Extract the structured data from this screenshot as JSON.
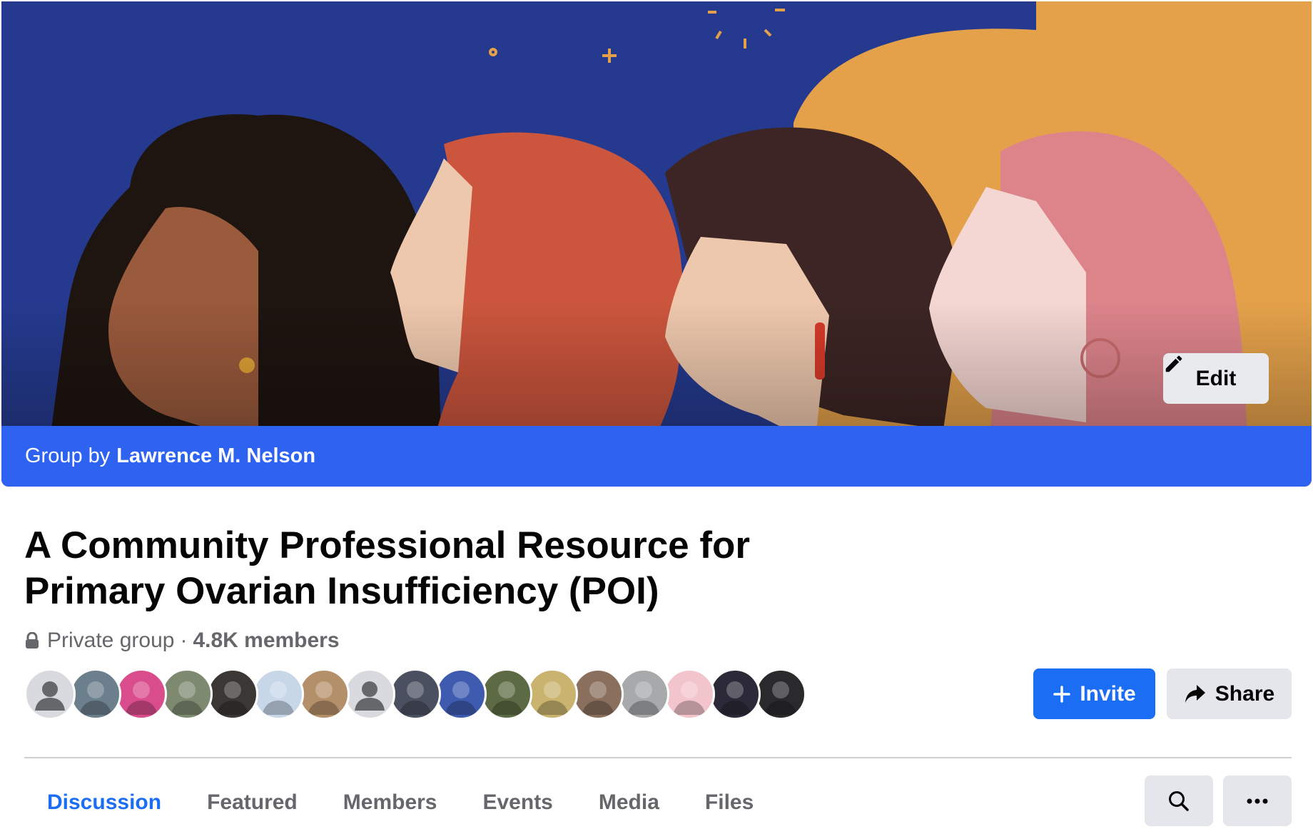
{
  "cover": {
    "edit_label": "Edit",
    "colors": {
      "sky": "#253a8f",
      "sun": "#e4a14a"
    }
  },
  "banner": {
    "prefix": "Group by",
    "owner": "Lawrence M. Nelson",
    "color": "#2d63f0"
  },
  "group": {
    "title": "A Community Professional Resource for Primary Ovarian Insufficiency (POI)",
    "privacy": "Private group",
    "separator": "·",
    "members": "4.8K members"
  },
  "actions": {
    "invite_label": "Invite",
    "share_label": "Share",
    "accent": "#1b6ef3"
  },
  "member_avatars": [
    {
      "name": "default-avatar",
      "color": "#d8dadf",
      "placeholder": true
    },
    {
      "name": "landscape-avatar",
      "color": "#6b7f8c"
    },
    {
      "name": "woman-pink-avatar",
      "color": "#d94d8c"
    },
    {
      "name": "outdoor-road-avatar",
      "color": "#7d8a70"
    },
    {
      "name": "dark-photo-avatar",
      "color": "#3a3734"
    },
    {
      "name": "man-sky-avatar",
      "color": "#c7d7e8"
    },
    {
      "name": "family-avatar",
      "color": "#b4906a"
    },
    {
      "name": "default-avatar",
      "color": "#d8dadf",
      "placeholder": true
    },
    {
      "name": "group-photo-avatar",
      "color": "#4a5060"
    },
    {
      "name": "runner-flag-avatar",
      "color": "#3f5bb0"
    },
    {
      "name": "tree-couple-avatar",
      "color": "#5d6b45"
    },
    {
      "name": "field-family-avatar",
      "color": "#c9b36e"
    },
    {
      "name": "couple-selfie-avatar",
      "color": "#8a6f5d"
    },
    {
      "name": "silhouette-avatar",
      "color": "#a7a9ab"
    },
    {
      "name": "cartoon-face-avatar",
      "color": "#f2c4cc"
    },
    {
      "name": "night-selfie-avatar",
      "color": "#2c2a38"
    },
    {
      "name": "dark-portrait-avatar",
      "color": "#2a2a2c"
    }
  ],
  "tabs": [
    {
      "label": "Discussion",
      "active": true
    },
    {
      "label": "Featured",
      "active": false
    },
    {
      "label": "Members",
      "active": false
    },
    {
      "label": "Events",
      "active": false
    },
    {
      "label": "Media",
      "active": false
    },
    {
      "label": "Files",
      "active": false
    }
  ],
  "tools": {
    "search_icon": "search-icon",
    "more_icon": "more-icon"
  }
}
